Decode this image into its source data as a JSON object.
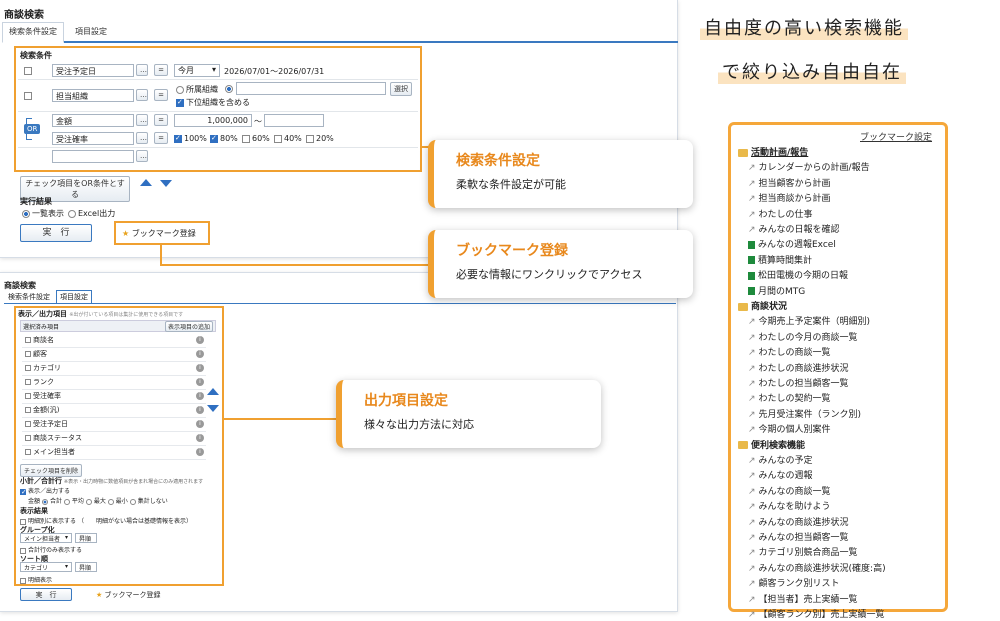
{
  "top": {
    "title": "商談検索",
    "tabs": [
      "検索条件設定",
      "項目設定"
    ],
    "section_label": "検索条件",
    "rows": [
      {
        "field": "受注予定日",
        "op": "=",
        "select": "今月",
        "value": "2026/07/01～2026/07/31"
      },
      {
        "field": "担当組織",
        "op": "=",
        "radio1": "所属組織",
        "select_btn": "選択",
        "sub_check": "下位組織を含める"
      },
      {
        "field": "金額",
        "op": "=",
        "value": "1,000,000",
        "tilde": "～"
      },
      {
        "field": "受注確率",
        "op": "=",
        "checks": [
          "100%",
          "80%",
          "60%",
          "40%",
          "20%"
        ]
      }
    ],
    "or_label": "OR",
    "or_button": "チェック項目をOR条件とする",
    "result_label": "実行結果",
    "result_options": [
      "一覧表示",
      "Excel出力"
    ],
    "run_button": "実　行",
    "bookmark_button": "ブックマーク登録"
  },
  "bottom": {
    "title": "商談検索",
    "tabs": [
      "検索条件設定",
      "項目設定"
    ],
    "section_label": "表示／出力項目",
    "section_note": "※出が付いている項目は集計に使用できる項目です",
    "col_header": "選択済み項目",
    "add_button": "表示項目の追加",
    "items": [
      "商談名",
      "顧客",
      "カテゴリ",
      "ランク",
      "受注確率",
      "金額(汎)",
      "受注予定日",
      "商談ステータス",
      "メイン担当者"
    ],
    "delete_button": "チェック項目を削除",
    "subtotal_label": "小計／合計行",
    "subtotal_note": "※表示・出力時物に数値項目が含まれ場合にのみ適用されます",
    "show_output": "表示／出力する",
    "agg_label": "金額",
    "agg_options": [
      "合計",
      "平均",
      "最大",
      "最小",
      "集計しない"
    ],
    "display_label": "表示結果",
    "display_check": "明細別に表示する",
    "display_note": "（　　明細がない場合は基礎情報を表示）",
    "group_label": "グループ化",
    "group_select": "メイン担当者",
    "group_order": "昇順",
    "group_check": "合計行のみ表示する",
    "sort_label": "ソート順",
    "sort_select": "カテゴリ",
    "sort_order": "昇順",
    "limit_check": "明細表示",
    "run_button": "実　行",
    "bookmark_button": "ブックマーク登録"
  },
  "callouts": [
    {
      "title": "検索条件設定",
      "desc": "柔軟な条件設定が可能"
    },
    {
      "title": "ブックマーク登録",
      "desc": "必要な情報にワンクリックでアクセス"
    },
    {
      "title": "出力項目設定",
      "desc": "様々な出力方法に対応"
    }
  ],
  "headline": {
    "line1": "自由度の高い検索機能",
    "line2": "で絞り込み自由自在"
  },
  "bookmarks": {
    "settings_link": "ブックマーク設定",
    "groups": [
      {
        "name": "活動計画/報告",
        "items": [
          "カレンダーからの計画/報告",
          "担当顧客から計画",
          "担当商談から計画",
          "わたしの仕事",
          "みんなの日報を確認",
          "みんなの週報Excel",
          "積算時間集計",
          "松田電機の今期の日報",
          "月間のMTG"
        ]
      },
      {
        "name": "商談状況",
        "items": [
          "今期売上予定案件（明細別)",
          "わたしの今月の商談一覧",
          "わたしの商談一覧",
          "わたしの商談進捗状況",
          "わたしの担当顧客一覧",
          "わたしの契約一覧",
          "先月受注案件（ランク別)",
          "今期の個人別案件"
        ]
      },
      {
        "name": "便利検索機能",
        "items": [
          "みんなの予定",
          "みんなの週報",
          "みんなの商談一覧",
          "みんなを助けよう",
          "みんなの商談進捗状況",
          "みんなの担当顧客一覧",
          "カテゴリ別競合商品一覧",
          "みんなの商談進捗状況(確度:高)",
          "顧客ランク別リスト",
          "【担当者】売上実績一覧",
          "【顧客ランク別】売上実績一覧"
        ]
      }
    ]
  },
  "colors": {
    "accent": "#f0a030",
    "brand": "#2f6fc1"
  }
}
